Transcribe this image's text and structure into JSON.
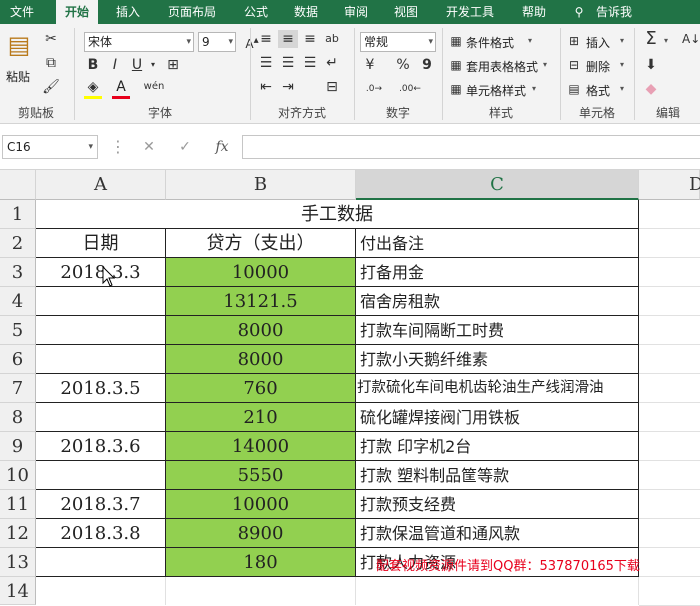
{
  "menu": {
    "items": [
      "文件",
      "开始",
      "插入",
      "页面布局",
      "公式",
      "数据",
      "审阅",
      "视图",
      "开发工具",
      "帮助"
    ],
    "tell_me": "告诉我"
  },
  "ribbon": {
    "clipboard": {
      "paste": "粘贴",
      "label": "剪贴板"
    },
    "font": {
      "name": "宋体",
      "size": "9",
      "bold": "B",
      "italic": "I",
      "underline": "U",
      "wen": "wén",
      "label": "字体"
    },
    "alignment": {
      "label": "对齐方式"
    },
    "number": {
      "format": "常规",
      "percent": "%",
      "comma": "9",
      "label": "数字"
    },
    "styles": {
      "conditional": "条件格式",
      "table": "套用表格格式",
      "cell": "单元格样式",
      "label": "样式"
    },
    "cells": {
      "insert": "插入",
      "delete": "删除",
      "format": "格式",
      "label": "单元格"
    },
    "editing": {
      "label": "编辑"
    }
  },
  "formula_bar": {
    "name_box": "C16",
    "fx": "fx",
    "cancel": "✕",
    "enter": "✓",
    "value": ""
  },
  "columns": [
    "A",
    "B",
    "C",
    "D"
  ],
  "selected_column": "C",
  "rows": [
    "1",
    "2",
    "3",
    "4",
    "5",
    "6",
    "7",
    "8",
    "9",
    "10",
    "11",
    "12",
    "13",
    "14"
  ],
  "sheet": {
    "title": "手工数据",
    "headers": {
      "a": "日期",
      "b": "贷方（支出）",
      "c": "付出备注"
    },
    "records": [
      {
        "a": "2018.3.3",
        "b": "10000",
        "c": "打备用金"
      },
      {
        "a": "",
        "b": "13121.5",
        "c": "宿舍房租款"
      },
      {
        "a": "",
        "b": "8000",
        "c": "打款车间隔断工时费"
      },
      {
        "a": "",
        "b": "8000",
        "c": "打款小天鹅纤维素"
      },
      {
        "a": "2018.3.5",
        "b": "760",
        "c": "打款硫化车间电机齿轮油生产线润滑油"
      },
      {
        "a": "",
        "b": "210",
        "c": "硫化罐焊接阀门用铁板"
      },
      {
        "a": "2018.3.6",
        "b": "14000",
        "c": "打款  印字机2台"
      },
      {
        "a": "",
        "b": "5550",
        "c": "打款  塑料制品筐等款"
      },
      {
        "a": "2018.3.7",
        "b": "10000",
        "c": "打款预支经费"
      },
      {
        "a": "2018.3.8",
        "b": "8900",
        "c": "打款保温管道和通风款"
      },
      {
        "a": "",
        "b": "180",
        "c": "打款人力资源"
      }
    ]
  },
  "watermark": "配套视频资源件请到QQ群：537870165下载",
  "colors": {
    "accent": "#217346",
    "highlight": "#92d050"
  }
}
